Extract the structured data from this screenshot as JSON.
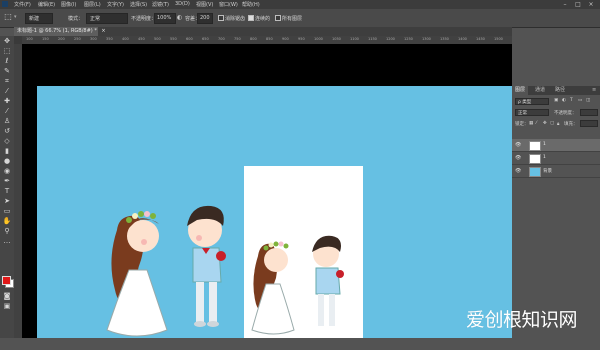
{
  "menubar": {
    "items": [
      "文件(F)",
      "编辑(E)",
      "图像(I)",
      "图层(L)",
      "文字(Y)",
      "选择(S)",
      "滤镜(T)",
      "3D(D)",
      "视图(V)",
      "窗口(W)",
      "帮助(H)"
    ]
  },
  "options": {
    "tool_icon": "selection-brush-icon",
    "add_label": "新建",
    "mode_label": "模式：",
    "mode_value": "正常",
    "opacity_label": "不透明度：",
    "opacity_value": "100%",
    "flow_label": "容差：",
    "flow_value": "200",
    "antialias_label": "消除锯齿",
    "contiguous_label": "连续的",
    "all_layers_label": "所有图层"
  },
  "document": {
    "tab_title": "未标题-1 @ 66.7% (1, RGB/8#) *",
    "close": "×"
  },
  "ruler": {
    "h_ticks": [
      "100",
      "150",
      "200",
      "250",
      "300",
      "350",
      "400",
      "450",
      "500",
      "550",
      "600",
      "650",
      "700",
      "750",
      "800",
      "850",
      "900",
      "950",
      "1000",
      "1050",
      "1100",
      "1150",
      "1200",
      "1250",
      "1300",
      "1350",
      "1400",
      "1450",
      "1500"
    ]
  },
  "layers_panel": {
    "tabs": [
      "图层",
      "通道",
      "路径"
    ],
    "filter_value": "ρ 类型",
    "blend_value": "正常",
    "opacity_label": "不透明度：",
    "lock_label": "锁定：",
    "fill_label": "填充：",
    "layers": [
      {
        "name": "1",
        "thumb": "figure"
      },
      {
        "name": "1",
        "thumb": "figure"
      },
      {
        "name": "背景",
        "thumb": "blue"
      }
    ]
  },
  "colors": {
    "canvas_bg": "#66c0e3",
    "foreground": "#e01818",
    "background": "#ffffff"
  },
  "watermark": "爱创根知识网"
}
